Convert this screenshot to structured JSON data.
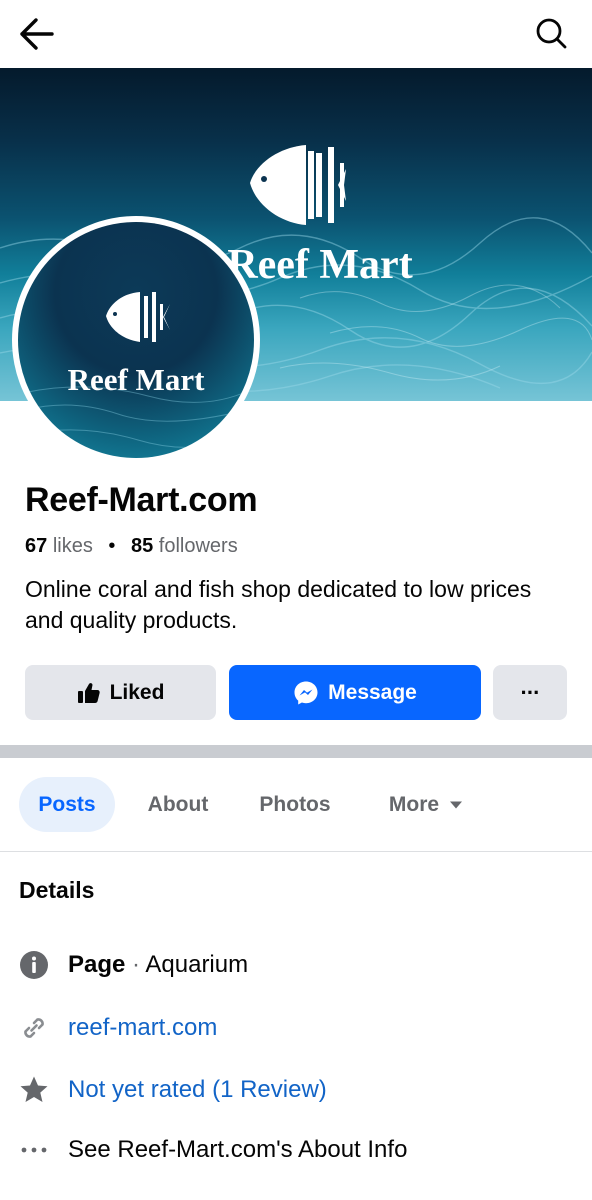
{
  "topbar": {
    "back_icon": "arrow-left-icon",
    "search_icon": "search-icon"
  },
  "cover": {
    "brand_text": "Reef Mart"
  },
  "avatar": {
    "brand_text": "Reef Mart"
  },
  "profile": {
    "name": "Reef-Mart.com",
    "likes_count": "67",
    "likes_label": "likes",
    "followers_count": "85",
    "followers_label": "followers",
    "bio": "Online coral and fish shop dedicated to low prices and quality products."
  },
  "actions": {
    "liked_label": "Liked",
    "message_label": "Message",
    "more_label": "···"
  },
  "tabs": [
    {
      "label": "Posts"
    },
    {
      "label": "About"
    },
    {
      "label": "Photos"
    },
    {
      "label": "More"
    }
  ],
  "details": {
    "title": "Details",
    "page_label": "Page",
    "page_separator": "·",
    "page_category": "Aquarium",
    "website": "reef-mart.com",
    "rating": "Not yet rated (1 Review)",
    "about_info": "See Reef-Mart.com's About Info"
  },
  "colors": {
    "accent": "#0866ff",
    "link": "#1264c7",
    "button_gray": "#e4e6eb",
    "tab_active_bg": "#e7f0fc"
  }
}
